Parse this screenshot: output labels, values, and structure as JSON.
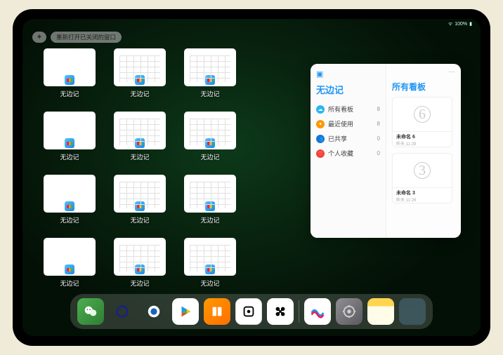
{
  "statusbar": {
    "time": "",
    "battery": "100%"
  },
  "toolbar": {
    "add_label": "+",
    "reopen_label": "重新打开已关闭的窗口"
  },
  "app_name": "无边记",
  "windows": [
    {
      "label": "无边记",
      "variant": "blank"
    },
    {
      "label": "无边记",
      "variant": "grid"
    },
    {
      "label": "无边记",
      "variant": "grid"
    },
    {
      "label": "无边记",
      "variant": "blank"
    },
    {
      "label": "无边记",
      "variant": "grid"
    },
    {
      "label": "无边记",
      "variant": "grid"
    },
    {
      "label": "无边记",
      "variant": "blank"
    },
    {
      "label": "无边记",
      "variant": "grid"
    },
    {
      "label": "无边记",
      "variant": "grid"
    },
    {
      "label": "无边记",
      "variant": "blank"
    },
    {
      "label": "无边记",
      "variant": "grid"
    },
    {
      "label": "无边记",
      "variant": "grid"
    }
  ],
  "panel": {
    "left_title": "无边记",
    "right_title": "所有看板",
    "ellipsis": "…",
    "categories": [
      {
        "icon": "c-blue",
        "glyph": "☁",
        "label": "所有看板",
        "count": "8"
      },
      {
        "icon": "c-orange",
        "glyph": "✦",
        "label": "最近使用",
        "count": "8"
      },
      {
        "icon": "c-dblue",
        "glyph": "👥",
        "label": "已共享",
        "count": "0"
      },
      {
        "icon": "c-red",
        "glyph": "♡",
        "label": "个人收藏",
        "count": "0"
      }
    ],
    "boards": [
      {
        "digit": "6",
        "name": "未命名 6",
        "date": "昨天 11:29"
      },
      {
        "digit": "3",
        "name": "未命名 3",
        "date": "昨天 11:29"
      }
    ]
  },
  "dock": [
    {
      "name": "wechat"
    },
    {
      "name": "quark"
    },
    {
      "name": "qqbrowser"
    },
    {
      "name": "play"
    },
    {
      "name": "books"
    },
    {
      "name": "dice"
    },
    {
      "name": "knot"
    },
    {
      "name": "sep"
    },
    {
      "name": "freeform"
    },
    {
      "name": "settings"
    },
    {
      "name": "notes"
    },
    {
      "name": "folder"
    }
  ]
}
